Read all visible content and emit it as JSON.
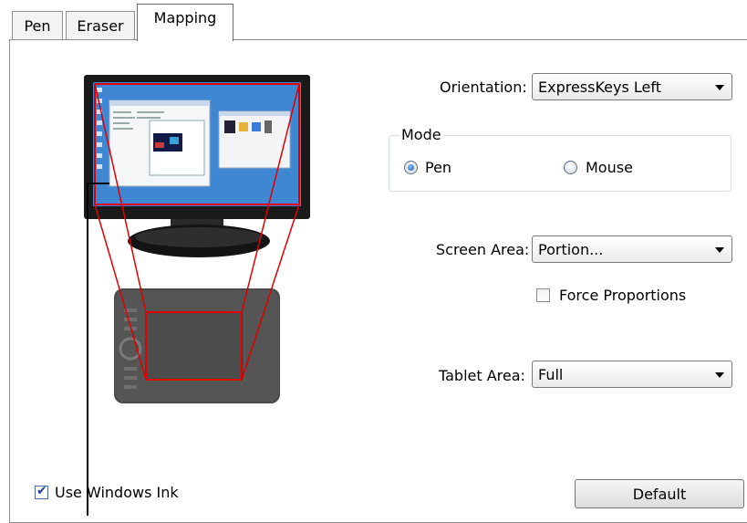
{
  "tabs": [
    {
      "label": "Pen",
      "active": false
    },
    {
      "label": "Eraser",
      "active": false
    },
    {
      "label": "Mapping",
      "active": true
    }
  ],
  "orientation": {
    "label": "Orientation:",
    "value": "ExpressKeys Left"
  },
  "mode": {
    "title": "Mode",
    "options": [
      {
        "label": "Pen",
        "selected": true
      },
      {
        "label": "Mouse",
        "selected": false
      }
    ]
  },
  "screen_area": {
    "label": "Screen Area:",
    "value": "Portion..."
  },
  "force_proportions": {
    "label": "Force Proportions",
    "checked": false
  },
  "tablet_area": {
    "label": "Tablet Area:",
    "value": "Full"
  },
  "windows_ink": {
    "label": "Use Windows Ink",
    "checked": true
  },
  "default_button": {
    "label": "Default"
  },
  "colors": {
    "mapping_lines": "#e00000",
    "screen_blue": "#3f86d3",
    "monitor_bezel": "#1a1a1a",
    "tablet_body": "#4a4a4a"
  }
}
